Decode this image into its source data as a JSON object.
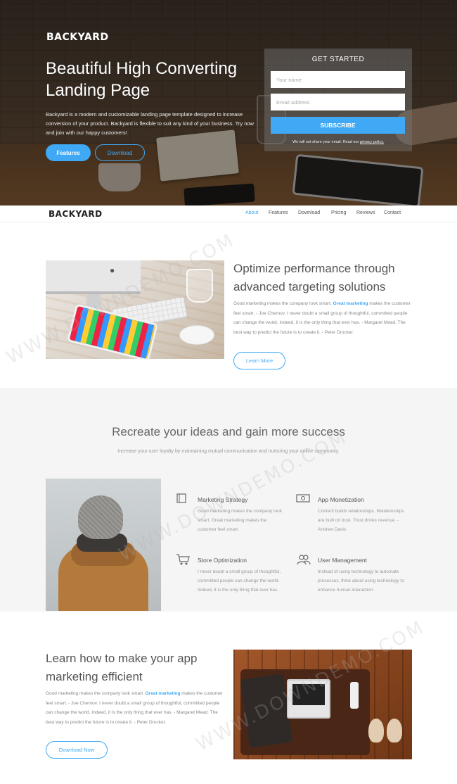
{
  "hero": {
    "logo": "BACKYARD",
    "title": "Beautiful High Converting Landing Page",
    "description": "Backyard is a modern and customizable landing page template designed to increase conversion of your product. Backyard is flexible to suit any kind of your business. Try now and join with our happy customers!",
    "features_label": "Features",
    "download_label": "Download"
  },
  "signup": {
    "title": "GET STARTED",
    "name_placeholder": "Your name",
    "email_placeholder": "Email address",
    "subscribe_label": "SUBSCRIBE",
    "note": "We will not share your email. Read our",
    "note_link": "privacy policy."
  },
  "nav": {
    "logo": "BACKYARD",
    "items": [
      "About",
      "Features",
      "Download",
      "Pricing",
      "Reviews",
      "Contact"
    ],
    "active": "About"
  },
  "section1": {
    "title": "Optimize performance through advanced targeting solutions",
    "text_before": "Good marketing makes the company look smart. ",
    "text_highlight": "Great marketing",
    "text_after": " makes the customer feel smart. - Joe Chernov. I never doubt a small group of thoughtful, committed people can change the world. Indeed, it is the only thing that ever has. - Margaret Mead. The best way to predict the future is to create it. - Peter Drucker.",
    "button": "Learn More"
  },
  "section2": {
    "title": "Recreate your ideas and gain more success",
    "subtitle": "Increase your user loyalty by maintaining mutual communication and nurturing your online community.",
    "features": [
      {
        "title": "Marketing Strategy",
        "text": "Good marketing makes the company look smart. Great marketing makes the customer feel smart.",
        "icon": "book-icon"
      },
      {
        "title": "App Monetization",
        "text": "Content builds relationships. Relationships are built on trust. Trust drives revenue. - Andrew Davis",
        "icon": "money-icon"
      },
      {
        "title": "Store Optimization",
        "text": "I never doubt a small group of thoughtful, committed people can change the world. Indeed, it is the only thing that ever has.",
        "icon": "cart-icon"
      },
      {
        "title": "User Management",
        "text": "Instead of using technology to automate processes, think about using technology to enhance human interaction.",
        "icon": "users-icon"
      }
    ]
  },
  "section3": {
    "title": "Learn how to make your app marketing efficient",
    "text_before": "Good marketing makes the company look smart. ",
    "text_highlight": "Great marketing",
    "text_after": " makes the customer feel smart. - Joe Chernov. I never doubt a small group of thoughtful, committed people can change the world. Indeed, it is the only thing that ever has. - Margaret Mead. The best way to predict the future is to create it. - Peter Drucker.",
    "button": "Download Now"
  },
  "watermark": "WWW.DOWNDEMO.COM",
  "colors": {
    "accent": "#3fa9f5",
    "section_bg": "#f5f5f5"
  }
}
